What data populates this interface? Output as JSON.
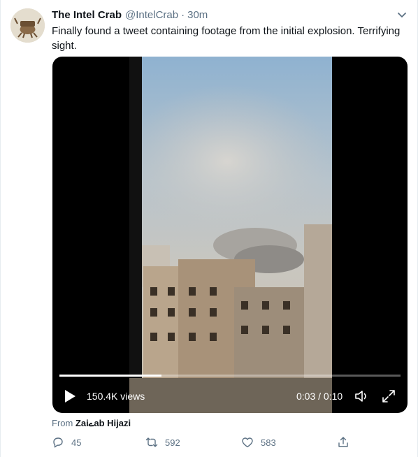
{
  "tweet": {
    "author_name": "The Intel Crab",
    "handle": "@IntelCrab",
    "separator": "·",
    "time": "30m",
    "text": "Finally found a tweet containing footage from the initial explosion. Terrifying sight.",
    "source_prefix": "From",
    "source_name": "Zaiےab Hijazi"
  },
  "video": {
    "views": "150.4K views",
    "timecode": "0:03 / 0:10",
    "progress_fraction": 0.3
  },
  "actions": {
    "reply_count": "45",
    "retweet_count": "592",
    "like_count": "583"
  },
  "icons": {
    "avatar": "crab-avatar-icon",
    "menu": "chevron-down-icon",
    "play": "play-icon",
    "volume": "volume-icon",
    "fullscreen": "fullscreen-icon",
    "reply": "reply-icon",
    "retweet": "retweet-icon",
    "like": "heart-icon",
    "share": "share-icon"
  },
  "colors": {
    "text": "#0f1419",
    "muted": "#5b7083",
    "video_bg": "#000000"
  }
}
